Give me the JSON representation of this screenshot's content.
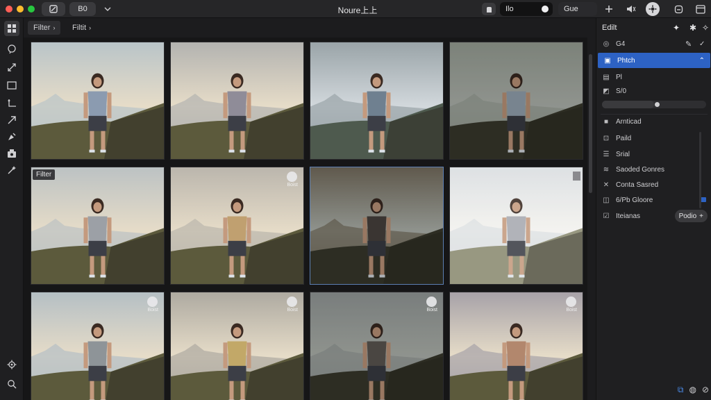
{
  "window": {
    "title": "Noure上上",
    "title_button": "B0",
    "toggle_label": "Ilo",
    "search_label": "Gue"
  },
  "filterbar": {
    "filter_label": "Filter",
    "filter_label_2": "Filtit"
  },
  "grid": {
    "tag_label": "Filter",
    "badge_text": "Boist",
    "thumbs": [
      {
        "tint": "#b9c4c8",
        "shirt": "#8b9bb0",
        "tone": "warm"
      },
      {
        "tint": "#b3b3b0",
        "shirt": "#8f8c98",
        "tone": "warm"
      },
      {
        "tint": "#9aa4a8",
        "shirt": "#6f8090",
        "tone": "cool"
      },
      {
        "tint": "#9fa79c",
        "shirt": "#9aaab8",
        "tone": "dark"
      },
      {
        "tint": "#bcc2c3",
        "shirt": "#9ca0a6",
        "tone": "warm"
      },
      {
        "tint": "#bbb6ad",
        "shirt": "#c0a070",
        "tone": "warm"
      },
      {
        "tint": "#7b7363",
        "shirt": "#4b4540",
        "tone": "dark"
      },
      {
        "tint": "#d9dde0",
        "shirt": "#a7a9b0",
        "tone": "light"
      },
      {
        "tint": "#b5bfc4",
        "shirt": "#8e9498",
        "tone": "warm"
      },
      {
        "tint": "#aeaaa1",
        "shirt": "#c2a868",
        "tone": "warm"
      },
      {
        "tint": "#9ba1a0",
        "shirt": "#5f5a55",
        "tone": "dark"
      },
      {
        "tint": "#a7a2a8",
        "shirt": "#b2876d",
        "tone": "warm"
      }
    ]
  },
  "panel": {
    "edit_label": "Edilt",
    "section_g4": "G4",
    "selected_item": "Phtch",
    "item_pi": "Pl",
    "item_s0": "S/0",
    "section_adjust": "Arnticad",
    "item_paild": "Paild",
    "item_srial": "Srial",
    "item_saoded": "Saoded Gonres",
    "item_contr": "Conta Sasred",
    "item_6pb": "6/Pb Gloore",
    "item_iteiana": "Iteianas",
    "button_pedio": "Podio"
  },
  "slider_value": 0.5,
  "colors": {
    "accent": "#2d62c4",
    "selection_border": "#5c7fb3",
    "background": "#1c1c1e"
  }
}
